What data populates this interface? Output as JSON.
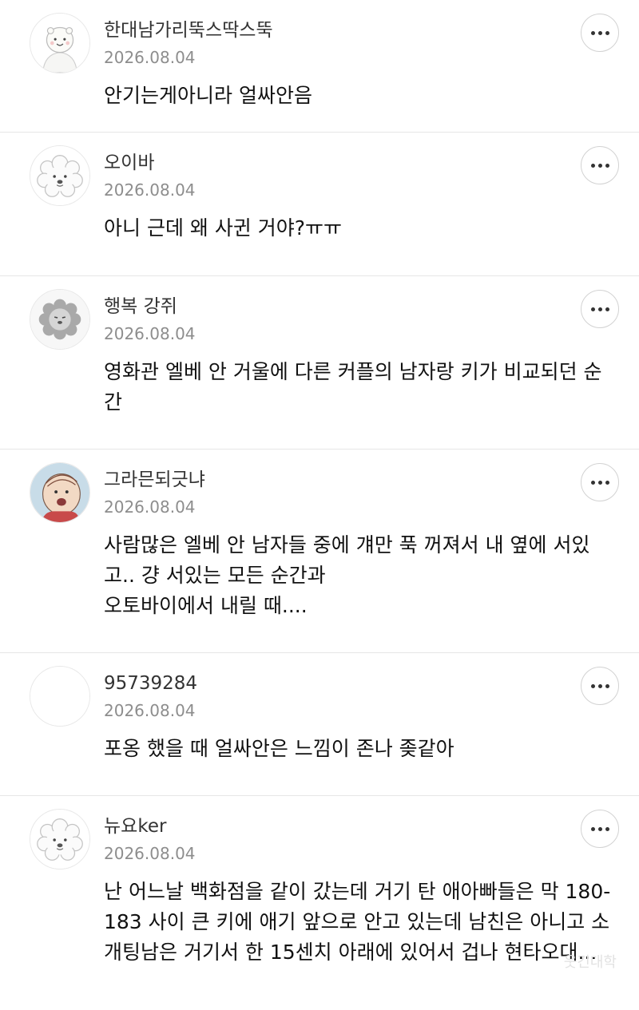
{
  "comments": [
    {
      "username": "한대남가리뚝스딱스뚝",
      "date": "2026.08.04",
      "text": "안기는게아니라 얼싸안음",
      "avatar": "smiling-bear-icon",
      "more_icon": "more-options-icon"
    },
    {
      "username": "오이바",
      "date": "2026.08.04",
      "text": "아니 근데 왜 사귄 거야?ㅠㅠ",
      "avatar": "curly-dog-icon",
      "more_icon": "more-options-icon"
    },
    {
      "username": "행복 강쥐",
      "date": "2026.08.04",
      "text": "영화관 엘베 안 거울에 다른 커플의 남자랑 키가 비교되던 순간",
      "avatar": "gray-lion-icon",
      "more_icon": "more-options-icon"
    },
    {
      "username": "그라믄되긋냐",
      "date": "2026.08.04",
      "text": "사람많은 엘베 안 남자들 중에 걔만 푹 꺼져서 내 옆에 서있고.. 걍 서있는 모든 순간과\n오토바이에서 내릴 때....",
      "avatar": "cartoon-boy-icon",
      "more_icon": "more-options-icon"
    },
    {
      "username": "95739284",
      "date": "2026.08.04",
      "text": "포옹 했을 때 얼싸안은 느낌이 존나 좆같아",
      "avatar": "blank-avatar-icon",
      "more_icon": "more-options-icon"
    },
    {
      "username": "뉴요ker",
      "date": "2026.08.04",
      "text": "난 어느날 백화점을 같이 갔는데 거기 탄 애아빠들은 막 180-183 사이 큰 키에 애기 앞으로 안고 있는데 남친은 아니고 소개팅남은 거기서 한 15센치 아래에 있어서 겁나 현타오대...",
      "avatar": "curly-dog-icon",
      "more_icon": "more-options-icon"
    }
  ],
  "watermark": "웃긴대학"
}
